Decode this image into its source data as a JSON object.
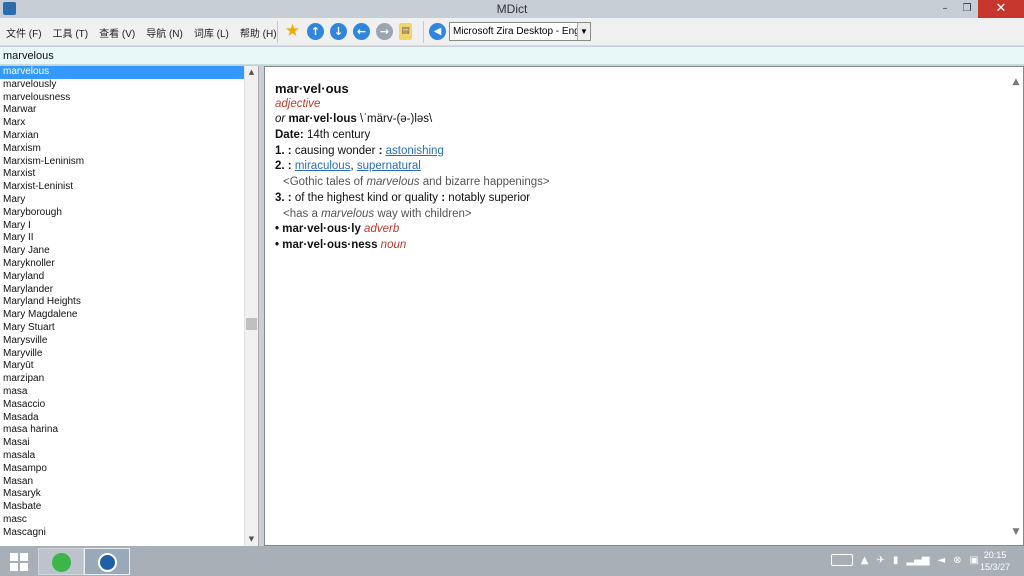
{
  "window": {
    "title": "MDict"
  },
  "window_controls": {
    "minimize": "–",
    "restore": "❐",
    "close": "✕"
  },
  "menu": [
    "文件 (F)",
    "工具 (T)",
    "查看 (V)",
    "导航 (N)",
    "词库 (L)",
    "帮助 (H)"
  ],
  "toolbar": {
    "voice_selected": "Microsoft Zira Desktop - Eng"
  },
  "search": {
    "value": "marvelous"
  },
  "wordlist": [
    "marvelous",
    "marvelously",
    "marvelousness",
    "Marwar",
    "Marx",
    "Marxian",
    "Marxism",
    "Marxism-Leninism",
    "Marxist",
    "Marxist-Leninist",
    "Mary",
    "Maryborough",
    "Mary I",
    "Mary II",
    "Mary Jane",
    "Maryknoller",
    "Maryland",
    "Marylander",
    "Maryland Heights",
    "Mary Magdalene",
    "Mary Stuart",
    "Marysville",
    "Maryville",
    "Maryūt",
    "marzipan",
    "masa",
    "Masaccio",
    "Masada",
    "masa harina",
    "Masai",
    "masala",
    "Masampo",
    "Masan",
    "Masaryk",
    "Masbate",
    "masc",
    "Mascagni"
  ],
  "entry": {
    "headword": "mar·vel·ous",
    "pos": "adjective",
    "variant_prefix": "or",
    "variant": "mar·vel·lous",
    "pronunciation": "\\ˈmärv-(ə-)ləs\\",
    "date_label": "Date:",
    "date": "14th century",
    "sense1_num": "1.",
    "sense1_text": "causing wonder",
    "sense1_link": "astonishing",
    "sense2_num": "2.",
    "sense2_link1": "miraculous",
    "sense2_link2": "supernatural",
    "sense2_example_pre": "<Gothic tales of",
    "sense2_example_em": "marvelous",
    "sense2_example_post": "and bizarre happenings>",
    "sense3_num": "3.",
    "sense3_text": "of the highest kind or quality",
    "sense3_syn": "notably superior",
    "sense3_example_pre": "<has a",
    "sense3_example_em": "marvelous",
    "sense3_example_post": "way with children>",
    "derived1_word": "mar·vel·ous·ly",
    "derived1_pos": "adverb",
    "derived2_word": "mar·vel·ous·ness",
    "derived2_pos": "noun"
  },
  "taskbar": {
    "time": "20:15",
    "date": "15/3/27"
  }
}
